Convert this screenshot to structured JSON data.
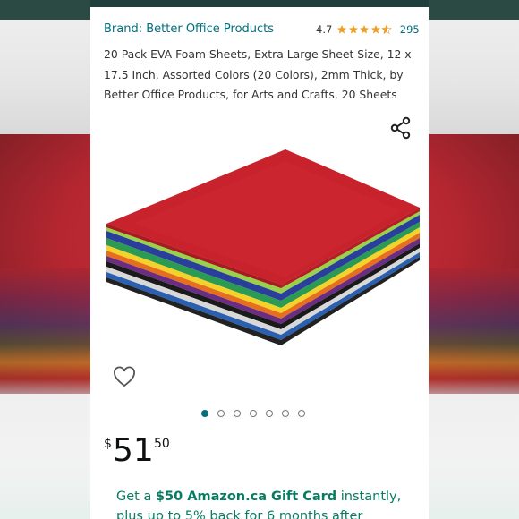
{
  "brand": {
    "label": "Brand: Better Office Products"
  },
  "rating": {
    "score": "4.7",
    "stars": 4.5,
    "count": "295"
  },
  "product": {
    "title": "20 Pack EVA Foam Sheets, Extra Large Sheet Size, 12 x 17.5 Inch, Assorted Colors (20 Colors), 2mm Thick, by Better Office Products, for Arts and Crafts, 20 Sheets"
  },
  "gallery": {
    "dot_count": 7,
    "active_index": 0
  },
  "price": {
    "currency": "$",
    "whole": "51",
    "fraction": "50"
  },
  "promo": {
    "prefix": "Get a ",
    "highlight": "$50 Amazon.ca Gift Card",
    "suffix": " instantly, plus up to 5% back for 6 months after"
  },
  "colors": {
    "accent": "#00707f",
    "star": "#f0a020",
    "promo": "#067d62",
    "foam_top": "#c8222d"
  },
  "icons": [
    "share-icon",
    "heart-icon",
    "star-icon"
  ]
}
